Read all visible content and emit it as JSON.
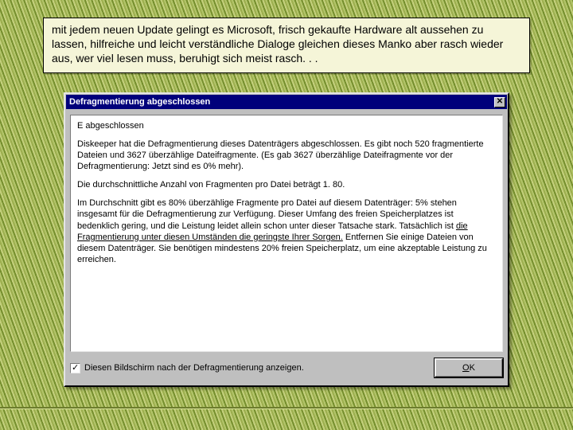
{
  "caption": "mit jedem neuen Update gelingt es Microsoft, frisch gekaufte Hardware alt aussehen zu lassen, hilfreiche und leicht verständliche Dialoge gleichen dieses Manko aber rasch wieder aus, wer viel lesen muss, beruhigt sich meist rasch. . .",
  "dialog": {
    "title": "Defragmentierung abgeschlossen",
    "close_glyph": "✕",
    "body": {
      "line1": "E abgeschlossen",
      "p1": "Diskeeper hat die Defragmentierung dieses Datenträgers abgeschlossen. Es gibt noch 520 fragmentierte Dateien und 3627 überzählige Dateifragmente. (Es gab 3627 überzählige Dateifragmente vor der Defragmentierung: Jetzt sind es 0% mehr).",
      "p2": "Die durchschnittliche Anzahl von Fragmenten pro Datei beträgt 1. 80.",
      "p3a": "Im Durchschnitt gibt es 80% überzählige Fragmente pro Datei auf diesem Datenträger: 5% stehen insgesamt für die Defragmentierung zur Verfügung. Dieser Umfang des freien Speicherplatzes ist bedenklich gering, und die Leistung leidet allein schon unter dieser Tatsache stark. Tatsächlich ist ",
      "p3u": "die Fragmentierung unter diesen Umständen die geringste Ihrer Sorgen.",
      "p3b": " Entfernen Sie einige Dateien von diesem Datenträger. Sie benötigen mindestens 20% freien Speicherplatz, um eine akzeptable Leistung zu erreichen."
    },
    "checkbox_label": "Diesen Bildschirm nach der Defragmentierung anzeigen.",
    "checkbox_checked": true,
    "ok_prefix": "O",
    "ok_rest": "K"
  }
}
